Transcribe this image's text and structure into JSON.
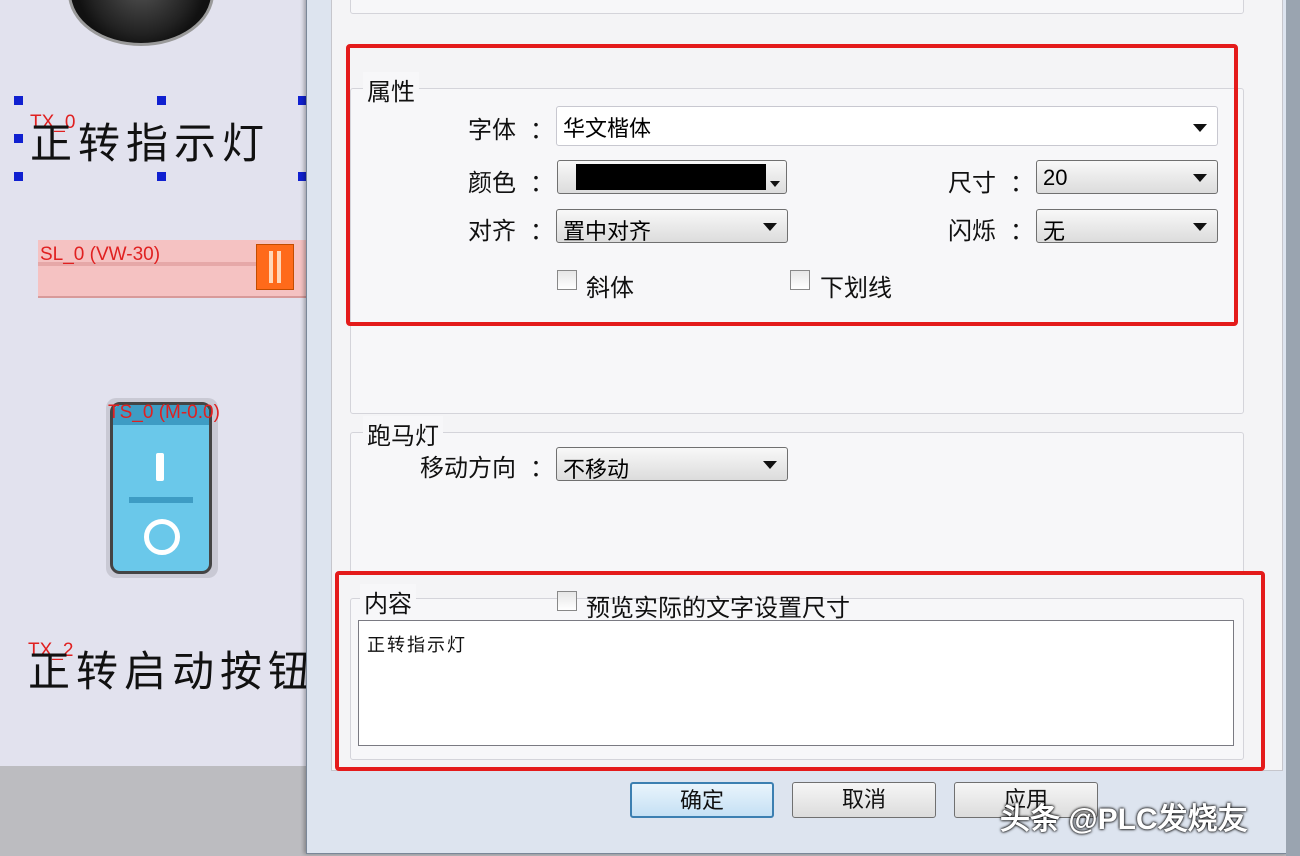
{
  "canvas": {
    "label_text_1": "正转指示灯",
    "tag_tx0": "TX_0",
    "slider_tag": "SL_0 (VW-30)",
    "switch_tag": "TS_0 (M-0.0)",
    "label_text_2": "正转启动按钮",
    "tag_tx2": "TX_2"
  },
  "properties": {
    "group_label": "属性",
    "font_label": "字体",
    "font_value": "华文楷体",
    "color_label": "颜色",
    "color_value": "#000000",
    "size_label": "尺寸",
    "size_value": "20",
    "align_label": "对齐",
    "align_value": "置中对齐",
    "blink_label": "闪烁",
    "blink_value": "无",
    "italic_label": "斜体",
    "underline_label": "下划线",
    "colon": "："
  },
  "marquee": {
    "group_label": "跑马灯",
    "direction_label": "移动方向",
    "direction_value": "不移动"
  },
  "content": {
    "group_label": "内容",
    "preview_label": "预览实际的文字设置尺寸",
    "text": "正转指示灯"
  },
  "buttons": {
    "ok": "确定",
    "cancel": "取消",
    "apply": "应用"
  },
  "watermark": "头条 @PLC发烧友",
  "colors": {
    "highlight": "#e41b1b",
    "slider": "#f5c2c2",
    "switch": "#6ac8ea"
  }
}
